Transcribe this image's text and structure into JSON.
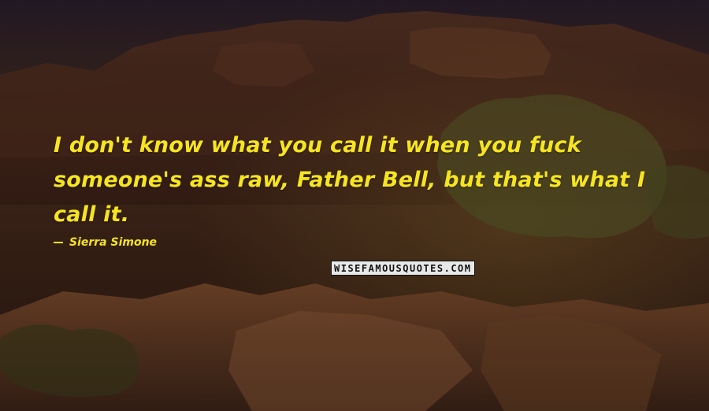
{
  "quote": {
    "text": "I don't know what you call it when you fuck someone's ass raw, Father Bell, but that's what I call it.",
    "author": "Sierra Simone"
  },
  "watermark": {
    "text": "WISEFAMOUSQUOTES.COM"
  },
  "colors": {
    "quote_text": "#f6e51f",
    "background_tone": "#3a2620"
  }
}
